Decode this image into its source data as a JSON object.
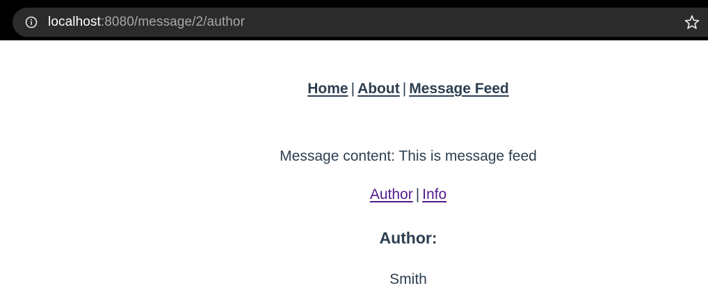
{
  "browser": {
    "info_icon": "info-icon",
    "url_host": "localhost",
    "url_path": ":8080/message/2/author",
    "star_icon": "star-icon"
  },
  "nav": {
    "home": "Home",
    "separator1": "|",
    "about": "About",
    "separator2": "|",
    "message_feed": "Message Feed"
  },
  "message": {
    "content": "Message content: This is message feed"
  },
  "sublinks": {
    "author": "Author",
    "separator": "|",
    "info": "Info"
  },
  "author": {
    "heading": "Author:",
    "name": "Smith"
  },
  "colors": {
    "text": "#2c3e50",
    "visited_link": "#551a8b",
    "browser_bar": "#2b2b2b"
  }
}
